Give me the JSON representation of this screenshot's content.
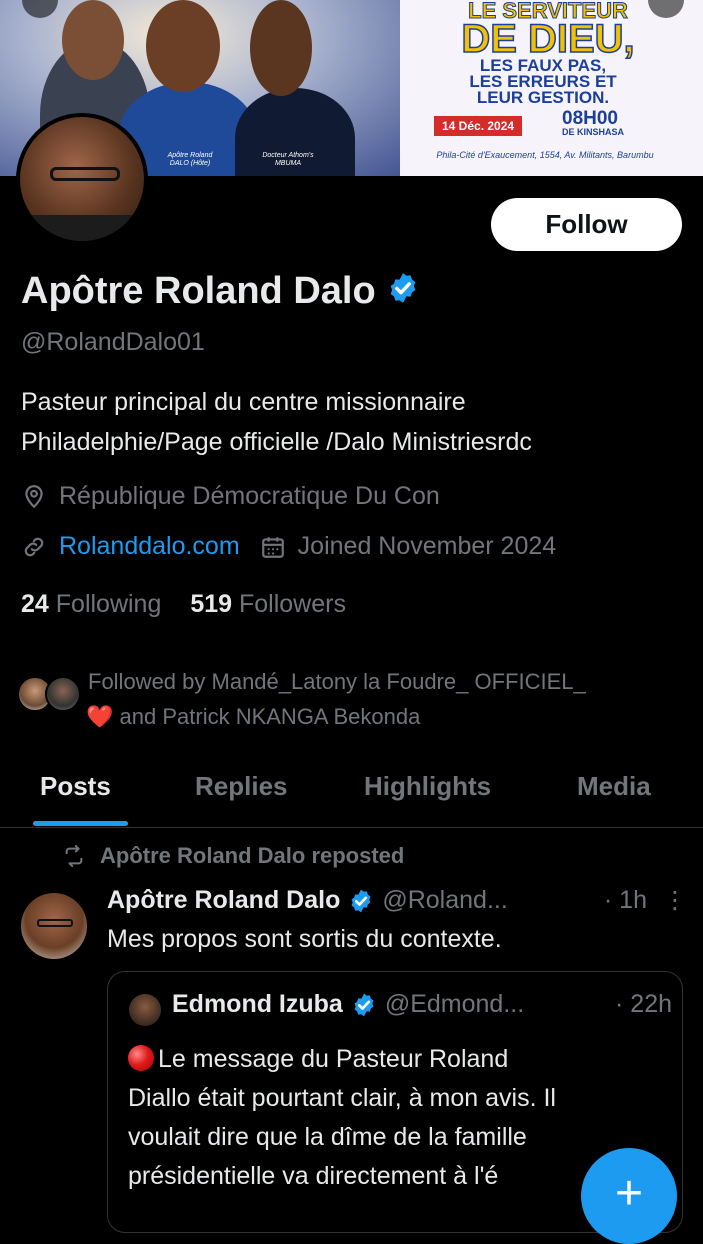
{
  "banner": {
    "title_line1": "LE SERVITEUR",
    "title_line2": "DE DIEU,",
    "subtitle_line1": "LES FAUX PAS,",
    "subtitle_line2": "LES ERREURS ET",
    "subtitle_line3": "LEUR GESTION.",
    "date": "14 Déc. 2024",
    "time": "08H00",
    "time_zone": "DE KINSHASA",
    "venue": "Phila-Cité d'Exaucement, 1554, Av. Militants, Barumbu",
    "caption_left": "Apôtre Roland DALO (Hôte)",
    "caption_right": "Docteur Athom's MBUMA"
  },
  "profile": {
    "follow_label": "Follow",
    "name": "Apôtre Roland Dalo",
    "handle": "@RolandDalo01",
    "bio_line1": "Pasteur principal du centre missionnaire",
    "bio_line2": "Philadelphie/Page officielle /Dalo Ministriesrdc",
    "location": "République Démocratique Du Con",
    "website": "Rolanddalo.com",
    "joined": "Joined November 2024",
    "following_count": "24",
    "following_label": "Following",
    "followers_count": "519",
    "followers_label": "Followers",
    "followed_by_line1": "Followed by Mandé_Latony la Foudre_ OFFICIEL_",
    "followed_by_line2": "and Patrick NKANGA Bekonda"
  },
  "tabs": [
    "Posts",
    "Replies",
    "Highlights",
    "Media"
  ],
  "post": {
    "repost_label": "Apôtre Roland Dalo reposted",
    "author_name": "Apôtre Roland Dalo",
    "author_handle": "@Roland...",
    "time": "· 1h",
    "text": "Mes propos sont sortis du contexte.",
    "quote": {
      "author_name": "Edmond Izuba",
      "author_handle": "@Edmond...",
      "time": "· 22h",
      "text_line1": "Le message du Pasteur Roland",
      "text_line2": "Diallo était pourtant clair, à mon avis. Il",
      "text_line3": "voulait dire que la dîme de la famille",
      "text_line4": "présidentielle va directement à l'é"
    }
  },
  "colors": {
    "background": "#000000",
    "accent": "#1d9bf0",
    "muted": "#71767b",
    "text": "#e7e9ea"
  }
}
